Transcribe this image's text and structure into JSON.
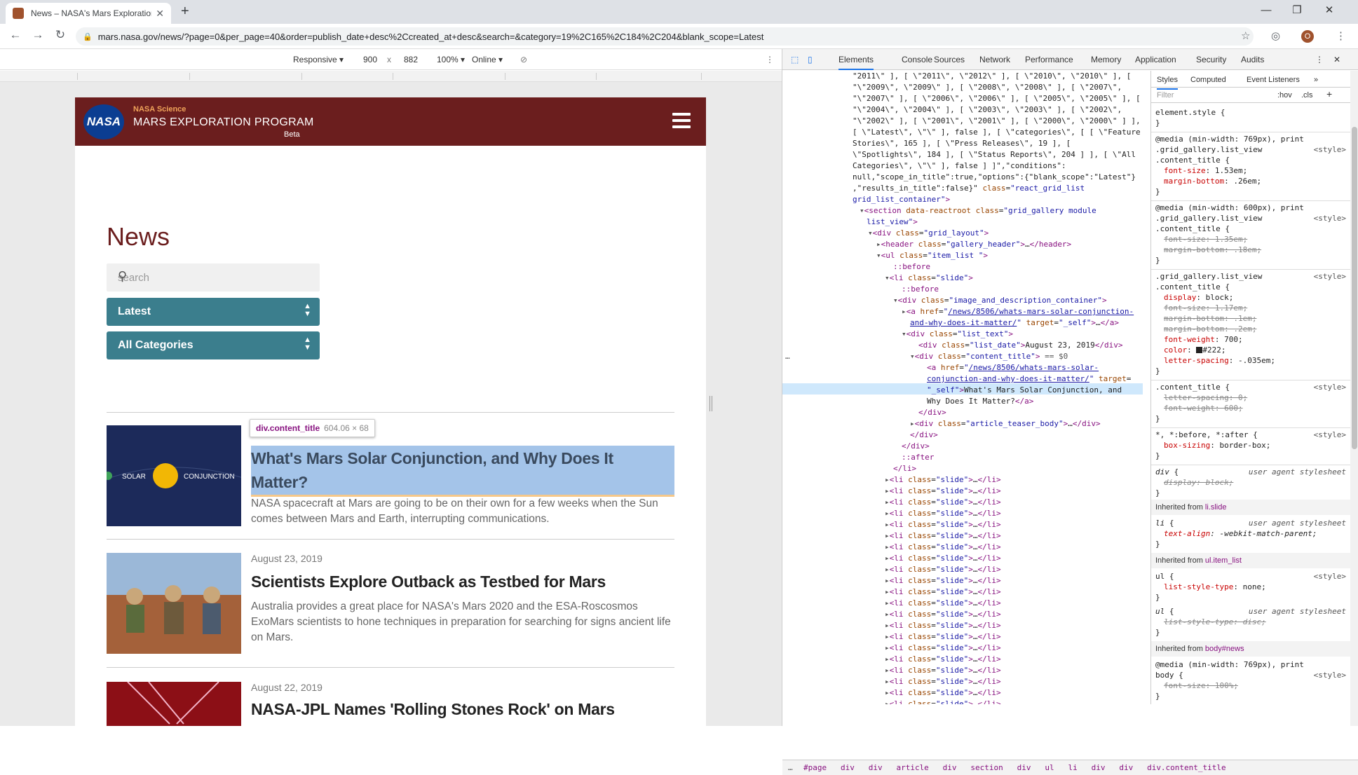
{
  "browser": {
    "tab_title": "News – NASA's Mars Exploration",
    "url": "mars.nasa.gov/news/?page=0&per_page=40&order=publish_date+desc%2Ccreated_at+desc&search=&category=19%2C165%2C184%2C204&blank_scope=Latest",
    "avatar_letter": "O"
  },
  "device_toolbar": {
    "mode": "Responsive",
    "width": "900",
    "times": "x",
    "height": "882",
    "zoom": "100%",
    "network": "Online"
  },
  "site": {
    "science": "NASA Science",
    "program": "MARS EXPLORATION PROGRAM",
    "beta": "Beta",
    "logo_text": "NASA",
    "page_title": "News",
    "search_placeholder": "search",
    "sort": "Latest",
    "category": "All Categories"
  },
  "articles": [
    {
      "title": "What's Mars Solar Conjunction, and Why Does It Matter?",
      "body": "NASA spacecraft at Mars are going to be on their own for a few weeks when the Sun comes between Mars and Earth, interrupting communications.",
      "image_left": "SOLAR",
      "image_right": "CONJUNCTION"
    },
    {
      "date": "August 23, 2019",
      "title": "Scientists Explore Outback as Testbed for Mars",
      "body": "Australia provides a great place for NASA's Mars 2020 and the ESA-Roscosmos ExoMars scientists to hone techniques in preparation for searching for signs ancient life on Mars."
    },
    {
      "date": "August 22, 2019",
      "title": "NASA-JPL Names 'Rolling Stones Rock' on Mars"
    }
  ],
  "tooltip": {
    "element": "div.content_title",
    "size": "604.06 × 68"
  },
  "devtools": {
    "tabs": [
      "Elements",
      "Console",
      "Sources",
      "Network",
      "Performance",
      "Memory",
      "Application",
      "Security",
      "Audits"
    ],
    "style_tabs": [
      "Styles",
      "Computed",
      "Event Listeners"
    ],
    "filter_placeholder": "Filter",
    "hov": ":hov",
    "cls": ".cls",
    "breadcrumb": "#page   div   div   article   div   section   div   ul   li   div   div   div.content_title"
  }
}
